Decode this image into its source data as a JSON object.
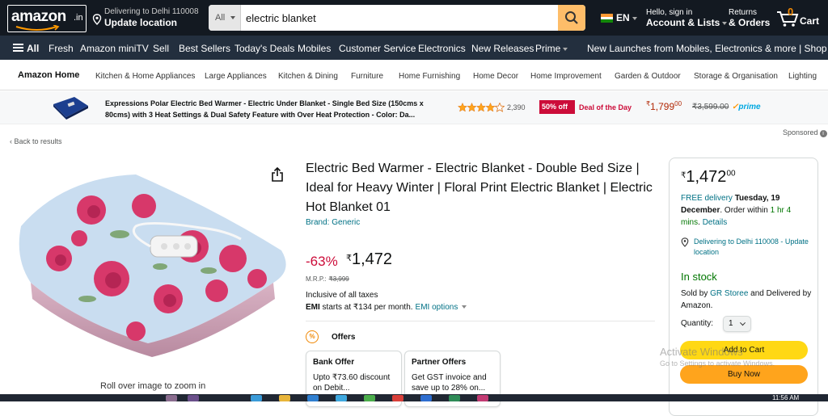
{
  "header": {
    "logo_text": "amazon",
    "logo_tld": ".in",
    "deliver_line1": "Delivering to Delhi 110008",
    "deliver_line2": "Update location",
    "search_category": "All",
    "search_value": "electric blanket",
    "language": "EN",
    "account_line1": "Hello, sign in",
    "account_line2": "Account & Lists",
    "returns_line1": "Returns",
    "returns_line2": "& Orders",
    "cart_count": "0",
    "cart_label": "Cart"
  },
  "nav": {
    "all_label": "All",
    "items": [
      "Fresh",
      "Amazon miniTV",
      "Sell",
      "Best Sellers",
      "Today's Deals",
      "Mobiles",
      "Customer Service",
      "Electronics",
      "New Releases",
      "Prime"
    ],
    "promo": "New Launches from Mobiles, Electronics & more | Shop now"
  },
  "subnav": {
    "home": "Amazon Home",
    "items": [
      "Kitchen & Home Appliances",
      "Large Appliances",
      "Kitchen & Dining",
      "Furniture",
      "Home Furnishing",
      "Home Decor",
      "Home Improvement",
      "Garden & Outdoor",
      "Storage & Organisation",
      "Lighting"
    ]
  },
  "banner": {
    "title": "Expressions Polar Electric Bed Warmer - Electric Under Blanket - Single Bed Size (150cms x 80cms) with 3 Heat Settings & Dual Safety Feature with Over Heat Protection - Color: Da...",
    "rating": 4,
    "rating_count": "2,390",
    "discount_badge": "50% off",
    "deal_label": "Deal of the Day",
    "price_symbol": "₹",
    "price": "1,799",
    "price_fraction": "00",
    "strike_price": "₹3,599.00",
    "prime_label": "prime"
  },
  "sponsored_label": "Sponsored",
  "back_link": "‹ Back to results",
  "image": {
    "rollover_hint": "Roll over image to zoom in"
  },
  "product": {
    "title": "Electric Bed Warmer - Electric Blanket - Double Bed Size | Ideal for Heavy Winter | Floral Print Electric Blanket | Electric Hot Blanket 01",
    "brand": "Brand: Generic",
    "discount": "-63%",
    "price_symbol": "₹",
    "price": "1,472",
    "mrp_label": "M.R.P.:",
    "mrp_value": "₹3,999",
    "taxes": "Inclusive of all taxes",
    "emi_bold": "EMI",
    "emi_text": " starts at ₹134 per month.",
    "emi_link": "EMI options",
    "offers_title": "Offers",
    "offers": [
      {
        "heading": "Bank Offer",
        "text": "Upto ₹73.60 discount on Debit..."
      },
      {
        "heading": "Partner Offers",
        "text": "Get GST invoice and save up to 28% on..."
      }
    ]
  },
  "buybox": {
    "price_symbol": "₹",
    "price": "1,472",
    "price_fraction": "00",
    "free_delivery": "FREE delivery",
    "delivery_date": "Tuesday, 19 December",
    "order_within": ". Order within ",
    "countdown": "1 hr 4 mins",
    "details": "Details",
    "location": "Delivering to Delhi 110008 - Update location",
    "stock": "In stock",
    "sold_prefix": "Sold by ",
    "seller": "GR Storee",
    "sold_suffix": " and Delivered by Amazon.",
    "qty_label": "Quantity:",
    "qty_value": "1",
    "add_to_cart": "Add to Cart",
    "buy_now": "Buy Now"
  },
  "watermark": {
    "line1": "Activate Windows",
    "line2": "Go to Settings to activate Windows."
  },
  "taskbar": {
    "clock": "11:56 AM"
  },
  "colors": {
    "header_bg": "#131921",
    "nav_bg": "#232f3e",
    "search_button": "#febd69",
    "add_to_cart": "#ffd814",
    "buy_now": "#ffa41c",
    "deal_red": "#cc0c39",
    "link_teal": "#007185",
    "in_stock_green": "#007600"
  }
}
